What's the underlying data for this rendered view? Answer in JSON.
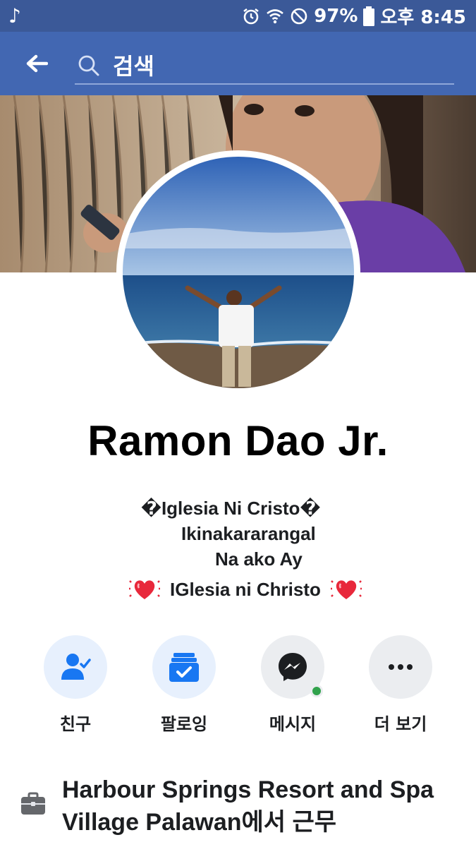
{
  "status_bar": {
    "battery": "97%",
    "time": "오후 8:45",
    "music_icon": "♪"
  },
  "header": {
    "search_placeholder": "검색"
  },
  "profile": {
    "name": "Ramon Dao Jr.",
    "bio": {
      "line1": "�Iglesia Ni Cristo�",
      "line2": "Ikinakararangal",
      "line3": "Na ako Ay",
      "line4": "IGlesia ni Christo"
    }
  },
  "actions": [
    {
      "label": "친구",
      "icon": "friends-check-icon"
    },
    {
      "label": "팔로잉",
      "icon": "following-icon"
    },
    {
      "label": "메시지",
      "icon": "messenger-icon"
    },
    {
      "label": "더 보기",
      "icon": "more-icon"
    }
  ],
  "work": {
    "text": "Harbour Springs Resort and Spa Village Palawan에서 근무"
  },
  "colors": {
    "status_bar": "#3b5998",
    "header": "#4267b2",
    "accent": "#1877f2",
    "online": "#31a24c"
  }
}
